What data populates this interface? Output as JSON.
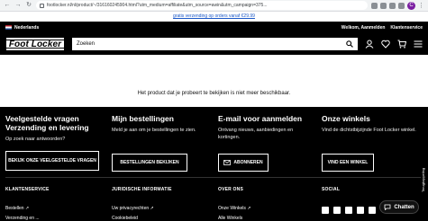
{
  "browser": {
    "url": "footlocker.nl/nl/product/~/316160245904.html?utm_medium=affiliate&utm_source=awin&utm_campaign=375..."
  },
  "promo": {
    "text": "gratis verzending op orders vanaf €29.99"
  },
  "util": {
    "locale": "Nederlands",
    "welcome": "Welkom, Aanmelden",
    "service": "Klantenservice"
  },
  "header": {
    "logo": "Foot Locker",
    "search_placeholder": "Zoeken"
  },
  "message": "Het product dat je probeert te bekijken is niet meer beschikbaar.",
  "footer": {
    "faq": {
      "title": "Veelgestelde vragen Verzending en levering",
      "text": "Op zoek naar antwoorden?",
      "button": "BEKIJK ONZE VEELGESTELDE VRAGEN"
    },
    "orders": {
      "title": "Mijn bestellingen",
      "text": "Meld je aan om je bestellingen te zien.",
      "button": "BESTELLINGEN BEKIJKEN"
    },
    "email": {
      "title": "E-mail voor aanmelden",
      "text": "Ontvang nieuws, aanbiedingen en kortingen.",
      "button": "ABONNEREN"
    },
    "stores": {
      "title": "Onze winkels",
      "text": "Vind de dichtstbijzijnde Foot Locker winkel.",
      "button": "VIND EEN WINKEL"
    },
    "sections": {
      "service": "KLANTENSERVICE",
      "legal": "JURIDISCHE INFORMATIE",
      "about": "OVER ONS",
      "social": "SOCIAL"
    },
    "links": {
      "orders": "Bestellen",
      "shipping": "Verzending en ...",
      "privacy": "Uw privacyrechten",
      "cookies": "Cookiebeleid",
      "stores": "Onze Winkels",
      "jobs": "Alle Winkels"
    }
  },
  "chat": "Chatten",
  "review_tab": "Terugkoppeling"
}
